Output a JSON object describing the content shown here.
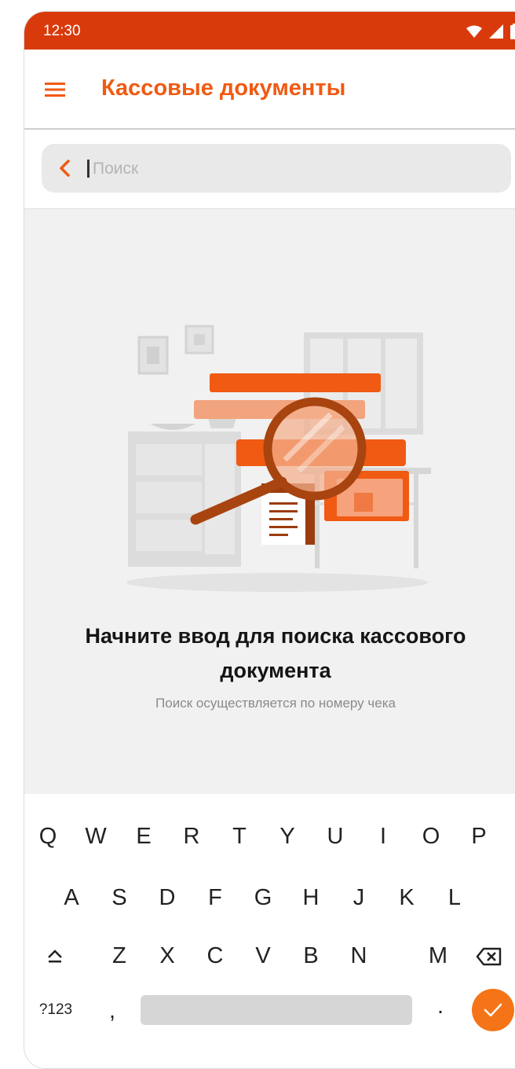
{
  "status_bar": {
    "time": "12:30",
    "icons": [
      "wifi-icon",
      "signal-icon",
      "battery-icon"
    ]
  },
  "app_bar": {
    "title": "Кассовые документы",
    "menu_icon": "hamburger-menu-icon"
  },
  "search": {
    "placeholder": "Поиск",
    "value": "",
    "back_icon": "chevron-left-icon"
  },
  "empty_state": {
    "title": "Начните ввод для поиска кассового документа",
    "subtitle": "Поиск осуществляется по номеру чека"
  },
  "keyboard": {
    "row1": [
      "Q",
      "W",
      "E",
      "R",
      "T",
      "Y",
      "U",
      "I",
      "O",
      "P"
    ],
    "row2": [
      "A",
      "S",
      "D",
      "F",
      "G",
      "H",
      "J",
      "K",
      "L"
    ],
    "row3": [
      "Z",
      "X",
      "C",
      "V",
      "B",
      "N",
      "M"
    ],
    "symbols_label": "?123",
    "comma_label": ",",
    "period_label": ".",
    "shift_icon": "shift-icon",
    "backspace_icon": "backspace-icon",
    "enter_icon": "check-icon"
  },
  "colors": {
    "status_bar": "#d93a0c",
    "accent": "#f05a13",
    "button": "#f47417"
  }
}
